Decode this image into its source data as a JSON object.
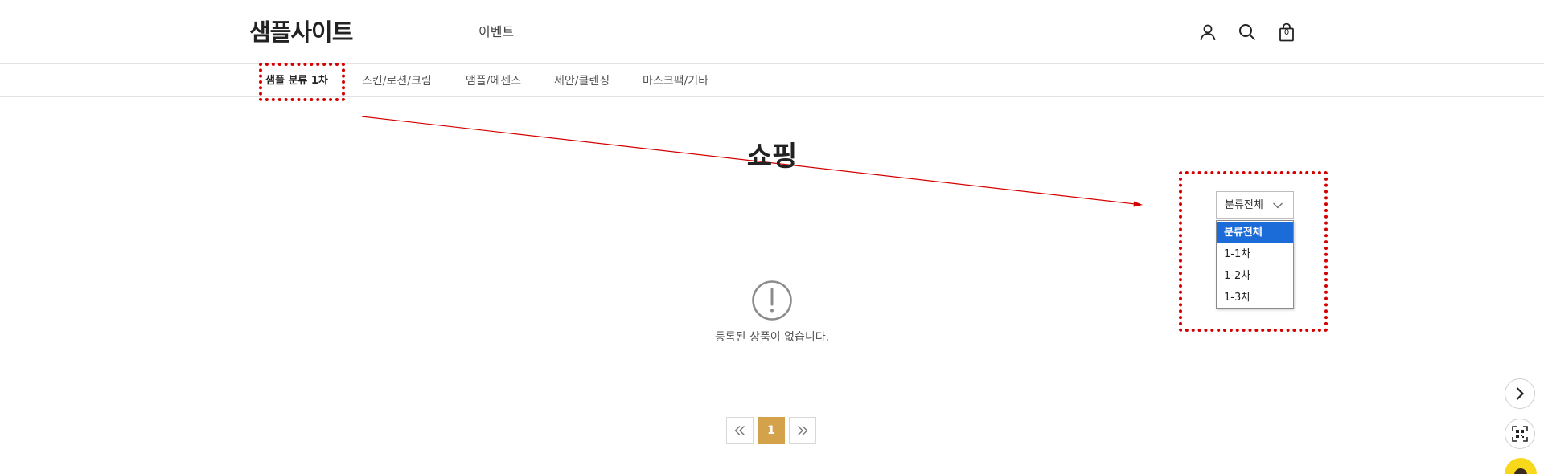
{
  "header": {
    "logo": "샘플사이트",
    "top_link": "이벤트",
    "cart_count": "0",
    "icons": [
      "user-icon",
      "search-icon",
      "cart-icon"
    ]
  },
  "category_nav": {
    "items": [
      {
        "label": "샘플 분류 1차",
        "active": true
      },
      {
        "label": "스킨/로션/크림",
        "active": false
      },
      {
        "label": "앰플/에센스",
        "active": false
      },
      {
        "label": "세안/클렌징",
        "active": false
      },
      {
        "label": "마스크팩/기타",
        "active": false
      }
    ]
  },
  "main": {
    "title": "쇼핑",
    "category_select": {
      "value": "분류전체",
      "options": [
        {
          "label": "분류전체",
          "selected": true
        },
        {
          "label": "1-1차",
          "selected": false
        },
        {
          "label": "1-2차",
          "selected": false
        },
        {
          "label": "1-3차",
          "selected": false
        }
      ]
    },
    "empty_message": "등록된 상품이 없습니다."
  },
  "pagination": {
    "current_page": "1",
    "icons": [
      "double-chevron-left-icon",
      "double-chevron-right-icon"
    ]
  },
  "floating": {
    "icons": [
      "chevron-right-icon",
      "qr-code-icon",
      "chat-icon"
    ]
  },
  "colors": {
    "accent": "#d3a24a",
    "annotation": "#d40000",
    "selected_option": "#1b6bd8",
    "chat_button": "#f7d81a"
  }
}
